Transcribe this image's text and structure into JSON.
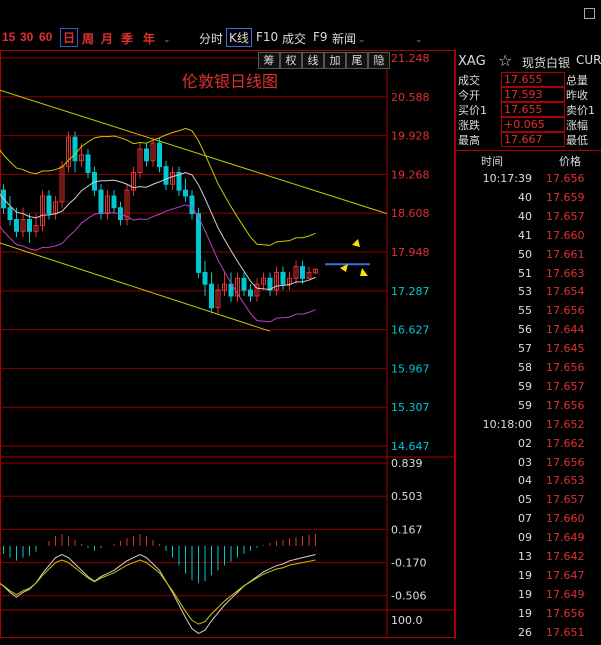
{
  "periods": [
    {
      "label": "15",
      "active": false
    },
    {
      "label": "30",
      "active": false
    },
    {
      "label": "60",
      "active": false
    },
    {
      "label": "日",
      "active": true
    },
    {
      "label": "周",
      "active": false
    },
    {
      "label": "月",
      "active": false
    },
    {
      "label": "季",
      "active": false
    },
    {
      "label": "年",
      "active": false
    }
  ],
  "toolbar": {
    "intraday": "分时",
    "kline": "K线",
    "f10": "F10",
    "trades": "成交",
    "f9": "F9",
    "news": "新闻"
  },
  "chart_tools": [
    "筹",
    "权",
    "线",
    "加",
    "尾",
    "隐"
  ],
  "chart_title": "伦敦银日线图",
  "price_axis": [
    "21.248",
    "20.588",
    "19.928",
    "19.268",
    "18.608",
    "17.948",
    "17.287",
    "16.627",
    "15.967",
    "15.307",
    "14.647"
  ],
  "macd_axis": [
    "0.839",
    "0.503",
    "0.167",
    "-0.170",
    "-0.506"
  ],
  "bottom_axis": "100.0",
  "info": {
    "symbol": "XAG",
    "name": "现货白银",
    "code": "CUR",
    "rows": [
      {
        "label": "成交",
        "value": "17.655",
        "label2": "总量"
      },
      {
        "label": "今开",
        "value": "17.593",
        "label2": "昨收"
      },
      {
        "label": "买价1",
        "value": "17.655",
        "label2": "卖价1"
      },
      {
        "label": "涨跌",
        "value": "+0.065",
        "label2": "涨幅"
      },
      {
        "label": "最高",
        "value": "17.667",
        "label2": "最低"
      }
    ],
    "time_header": "时间",
    "price_header": "价格"
  },
  "ticks": [
    {
      "time": "10:17:39",
      "price": "17.656"
    },
    {
      "time": "40",
      "price": "17.659"
    },
    {
      "time": "40",
      "price": "17.657"
    },
    {
      "time": "41",
      "price": "17.660"
    },
    {
      "time": "50",
      "price": "17.661"
    },
    {
      "time": "51",
      "price": "17.663"
    },
    {
      "time": "53",
      "price": "17.654"
    },
    {
      "time": "55",
      "price": "17.656"
    },
    {
      "time": "56",
      "price": "17.644"
    },
    {
      "time": "57",
      "price": "17.645"
    },
    {
      "time": "58",
      "price": "17.656"
    },
    {
      "time": "59",
      "price": "17.657"
    },
    {
      "time": "59",
      "price": "17.656"
    },
    {
      "time": "10:18:00",
      "price": "17.652"
    },
    {
      "time": "02",
      "price": "17.662"
    },
    {
      "time": "03",
      "price": "17.656"
    },
    {
      "time": "04",
      "price": "17.653"
    },
    {
      "time": "05",
      "price": "17.657"
    },
    {
      "time": "07",
      "price": "17.660"
    },
    {
      "time": "09",
      "price": "17.649"
    },
    {
      "time": "13",
      "price": "17.642"
    },
    {
      "time": "19",
      "price": "17.647"
    },
    {
      "time": "19",
      "price": "17.649"
    },
    {
      "time": "19",
      "price": "17.656"
    },
    {
      "time": "26",
      "price": "17.651"
    }
  ],
  "colors": {
    "up": "#e03030",
    "down": "#00c8d0",
    "grid": "#8b0000",
    "trendline": "#c8c800",
    "ma_white": "#d0d0d0",
    "boll_purple": "#c040c0",
    "boll_yellow": "#c8c800"
  },
  "chart_data": {
    "type": "candlestick",
    "title": "伦敦银日线图",
    "ylim": [
      14.647,
      21.248
    ],
    "yticks": [
      21.248,
      20.588,
      19.928,
      19.268,
      18.608,
      17.948,
      17.287,
      16.627,
      15.967,
      15.307,
      14.647
    ],
    "candles": [
      [
        19.3,
        19.0,
        19.4,
        18.9
      ],
      [
        19.0,
        18.7,
        19.1,
        18.6
      ],
      [
        18.7,
        18.5,
        18.9,
        18.4
      ],
      [
        18.5,
        18.3,
        18.7,
        18.2
      ],
      [
        18.3,
        18.5,
        18.7,
        18.2
      ],
      [
        18.5,
        18.3,
        18.6,
        18.1
      ],
      [
        18.3,
        18.4,
        18.6,
        18.2
      ],
      [
        18.4,
        18.9,
        19.0,
        18.3
      ],
      [
        18.9,
        18.6,
        19.0,
        18.5
      ],
      [
        18.6,
        18.8,
        18.9,
        18.5
      ],
      [
        18.8,
        19.4,
        19.5,
        18.7
      ],
      [
        19.4,
        19.9,
        20.0,
        19.3
      ],
      [
        19.9,
        19.5,
        20.0,
        19.3
      ],
      [
        19.5,
        19.6,
        19.8,
        19.4
      ],
      [
        19.6,
        19.3,
        19.7,
        19.2
      ],
      [
        19.3,
        19.0,
        19.4,
        18.9
      ],
      [
        19.0,
        18.6,
        19.1,
        18.5
      ],
      [
        18.6,
        18.9,
        19.0,
        18.5
      ],
      [
        18.9,
        18.7,
        19.0,
        18.6
      ],
      [
        18.7,
        18.5,
        18.8,
        18.4
      ],
      [
        18.5,
        19.0,
        19.1,
        18.4
      ],
      [
        19.0,
        19.3,
        19.4,
        18.9
      ],
      [
        19.3,
        19.7,
        19.8,
        19.2
      ],
      [
        19.7,
        19.5,
        19.8,
        19.4
      ],
      [
        19.5,
        19.8,
        19.9,
        19.4
      ],
      [
        19.8,
        19.4,
        19.9,
        19.3
      ],
      [
        19.4,
        19.1,
        19.5,
        19.0
      ],
      [
        19.1,
        19.3,
        19.4,
        19.0
      ],
      [
        19.3,
        19.0,
        19.4,
        18.9
      ],
      [
        19.0,
        18.9,
        19.2,
        18.8
      ],
      [
        18.9,
        18.6,
        19.0,
        18.5
      ],
      [
        18.6,
        17.6,
        18.7,
        17.5
      ],
      [
        17.6,
        17.4,
        17.8,
        17.2
      ],
      [
        17.4,
        17.0,
        17.6,
        16.9
      ],
      [
        17.0,
        17.3,
        17.4,
        16.9
      ],
      [
        17.3,
        17.4,
        17.6,
        17.2
      ],
      [
        17.4,
        17.2,
        17.6,
        17.1
      ],
      [
        17.2,
        17.5,
        17.6,
        17.1
      ],
      [
        17.5,
        17.3,
        17.6,
        17.2
      ],
      [
        17.3,
        17.2,
        17.4,
        17.1
      ],
      [
        17.2,
        17.4,
        17.5,
        17.1
      ],
      [
        17.4,
        17.5,
        17.6,
        17.3
      ],
      [
        17.5,
        17.3,
        17.6,
        17.2
      ],
      [
        17.3,
        17.6,
        17.7,
        17.2
      ],
      [
        17.6,
        17.4,
        17.7,
        17.3
      ],
      [
        17.4,
        17.5,
        17.6,
        17.3
      ],
      [
        17.5,
        17.7,
        17.8,
        17.4
      ],
      [
        17.7,
        17.5,
        17.8,
        17.4
      ],
      [
        17.5,
        17.6,
        17.7,
        17.5
      ],
      [
        17.593,
        17.655,
        17.667,
        17.58
      ]
    ],
    "macd_ylim": [
      -0.6,
      0.85
    ],
    "macd": [
      -0.05,
      -0.08,
      -0.12,
      -0.15,
      -0.12,
      -0.1,
      -0.06,
      0,
      0.05,
      0.1,
      0.12,
      0.1,
      0.06,
      0.02,
      -0.02,
      -0.05,
      -0.02,
      0,
      0.02,
      0.05,
      0.08,
      0.1,
      0.12,
      0.1,
      0.06,
      0.02,
      -0.05,
      -0.12,
      -0.2,
      -0.28,
      -0.35,
      -0.38,
      -0.36,
      -0.3,
      -0.25,
      -0.2,
      -0.16,
      -0.12,
      -0.08,
      -0.05,
      -0.02,
      0.01,
      0.03,
      0.05,
      0.06,
      0.08,
      0.09,
      0.1,
      0.11,
      0.12
    ]
  }
}
